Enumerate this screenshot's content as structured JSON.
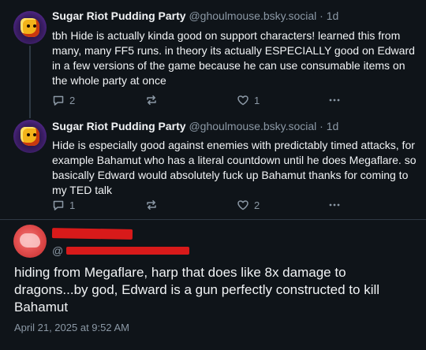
{
  "posts": [
    {
      "display_name": "Sugar Riot Pudding Party",
      "handle": "@ghoulmouse.bsky.social",
      "separator": "·",
      "time": "1d",
      "text": "tbh Hide is actually kinda good on support characters! learned this from many, many FF5 runs. in theory its actually ESPECIALLY good on Edward in a few versions of the game because he can use consumable items on the whole party at once",
      "reply_count": "2",
      "repost_count": "",
      "like_count": "1",
      "avatar_icon": "pixel-creature-avatar"
    },
    {
      "display_name": "Sugar Riot Pudding Party",
      "handle": "@ghoulmouse.bsky.social",
      "separator": "·",
      "time": "1d",
      "text": "Hide is especially good against enemies with predictably timed attacks, for example Bahamut who has a literal countdown until he does Megaflare. so basically Edward would absolutely fuck up Bahamut thanks for coming to my TED talk",
      "reply_count": "1",
      "repost_count": "",
      "like_count": "2",
      "avatar_icon": "pixel-creature-avatar"
    }
  ],
  "main_post": {
    "handle_prefix": "@",
    "text": "hiding from Megaflare, harp that does like 8x damage to dragons...by god, Edward is a gun perfectly constructed to kill Bahamut",
    "date": "April 21, 2025 at 9:52 AM"
  },
  "icons": {
    "reply": "speech-bubble-icon",
    "repost": "repost-arrows-icon",
    "like": "heart-icon",
    "more": "ellipsis-icon"
  },
  "colors": {
    "background": "#0f1419",
    "text": "#f1f3f5",
    "muted": "#8b98a5",
    "redaction": "#d81a1a"
  }
}
